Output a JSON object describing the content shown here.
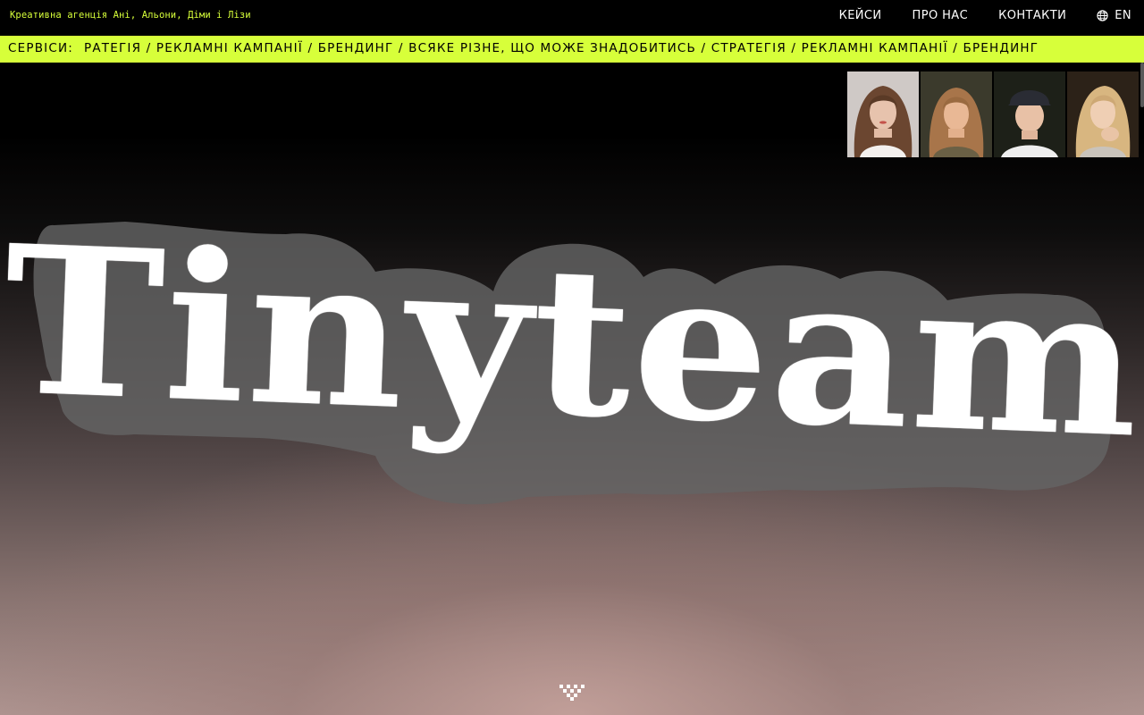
{
  "header": {
    "tagline": "Креативна агенція Ані, Альони, Діми і Лізи",
    "nav": [
      {
        "label": "КЕЙСИ"
      },
      {
        "label": "ПРО НАС"
      },
      {
        "label": "КОНТАКТИ"
      }
    ],
    "language": "EN"
  },
  "ticker": {
    "label": "СЕРВІСИ:",
    "text": "РАТЕГІЯ / РЕКЛАМНІ КАМПАНІЇ / БРЕНДИНГ / ВСЯКЕ РІЗНЕ, ЩО МОЖЕ ЗНАДОБИТИСЬ / СТРАТЕГІЯ / РЕКЛАМНІ КАМПАНІЇ / БРЕНДИНГ"
  },
  "hero": {
    "logo": "Tinyteam"
  },
  "colors": {
    "accent": "#d7ff3a",
    "background": "#000000",
    "sticker": "#5a5a5a"
  },
  "icons": {
    "language": "globe-icon",
    "scroll": "scroll-down-icon"
  }
}
